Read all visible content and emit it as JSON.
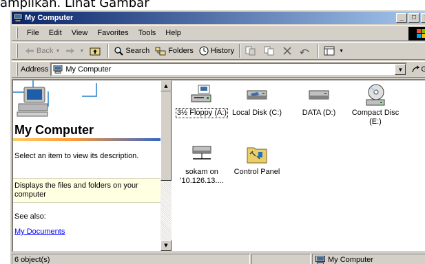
{
  "caption_text": "ampilkan. Lihat Gambar",
  "window": {
    "title": "My Computer",
    "controls": [
      "_",
      "□",
      "×"
    ]
  },
  "menu": [
    "File",
    "Edit",
    "View",
    "Favorites",
    "Tools",
    "Help"
  ],
  "toolbar": {
    "back": "Back",
    "search": "Search",
    "folders": "Folders",
    "history": "History"
  },
  "address": {
    "label": "Address",
    "value": "My Computer",
    "go": "Go"
  },
  "left_pane": {
    "heading": "My Computer",
    "hint": "Select an item to view its description.",
    "info": "Displays the files and folders on your computer",
    "see_also": "See also:",
    "link": "My Documents"
  },
  "items": [
    {
      "label": "3½ Floppy (A:)",
      "icon": "floppy-drive-icon"
    },
    {
      "label": "Local Disk (C:)",
      "icon": "hard-disk-icon"
    },
    {
      "label": "DATA (D:)",
      "icon": "hard-disk-icon"
    },
    {
      "label": "Compact Disc (E:)",
      "icon": "cd-drive-icon"
    },
    {
      "label": "sokam on '10.126.13....",
      "icon": "network-drive-icon"
    },
    {
      "label": "Control Panel",
      "icon": "control-panel-icon"
    }
  ],
  "status": {
    "count": "6 object(s)",
    "zone": "My Computer"
  }
}
